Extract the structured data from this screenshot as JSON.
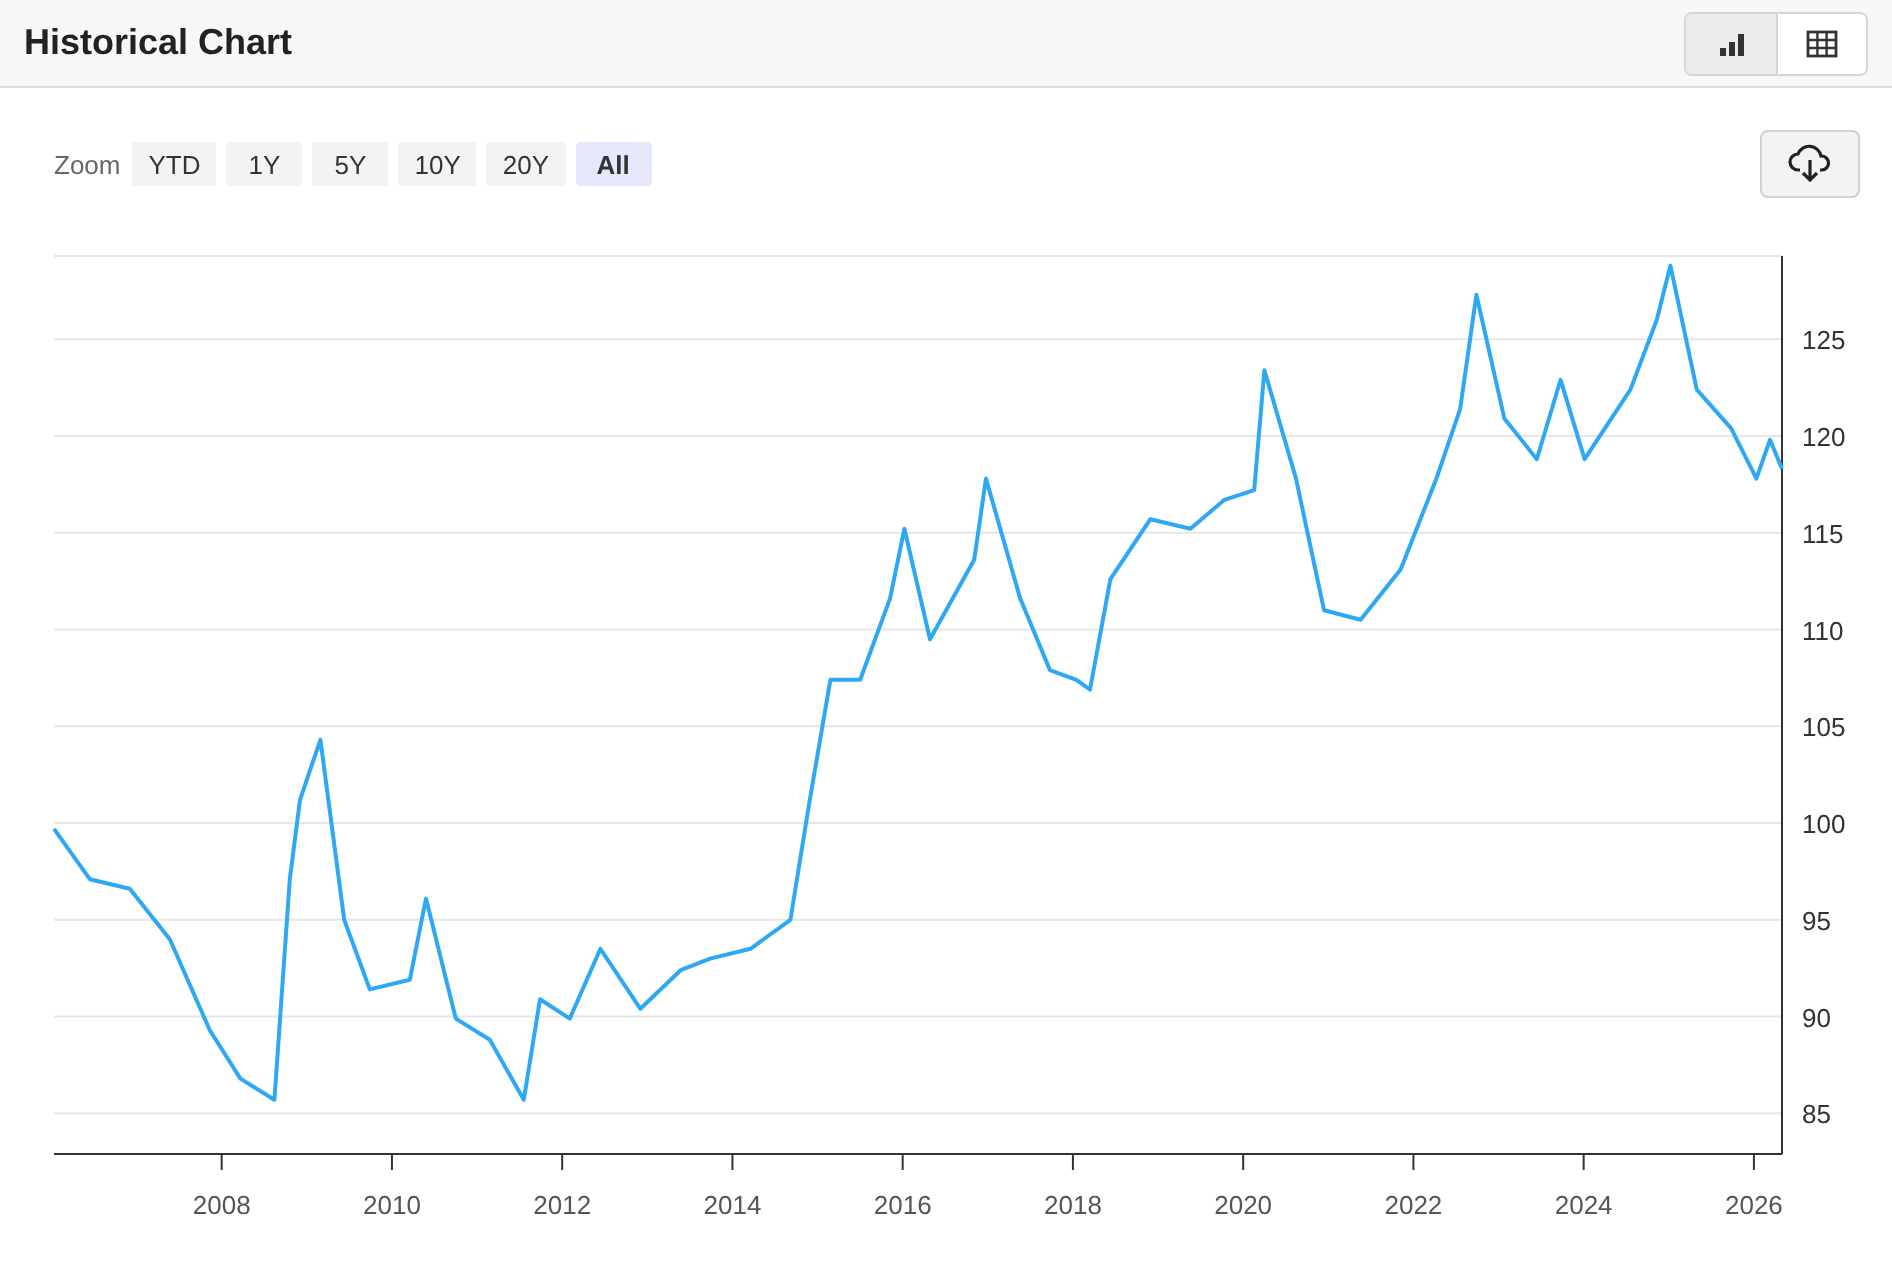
{
  "header": {
    "title": "Historical Chart",
    "views": [
      {
        "kind": "chart",
        "selected": true
      },
      {
        "kind": "table",
        "selected": false
      }
    ]
  },
  "zoom": {
    "label": "Zoom",
    "ranges": [
      {
        "label": "YTD",
        "selected": false
      },
      {
        "label": "1Y",
        "selected": false
      },
      {
        "label": "5Y",
        "selected": false
      },
      {
        "label": "10Y",
        "selected": false
      },
      {
        "label": "20Y",
        "selected": false
      },
      {
        "label": "All",
        "selected": true
      }
    ]
  },
  "chart_data": {
    "type": "line",
    "grid": true,
    "xlim": [
      2006.03,
      2026.33
    ],
    "ylim": [
      82.9,
      129.3
    ],
    "xticks": [
      2008,
      2010,
      2012,
      2014,
      2016,
      2018,
      2020,
      2022,
      2024,
      2026
    ],
    "yticks": [
      85,
      90,
      95,
      100,
      105,
      110,
      115,
      120,
      125
    ],
    "x": [
      2006.03,
      2006.45,
      2006.92,
      2007.39,
      2007.86,
      2008.22,
      2008.62,
      2008.8,
      2008.92,
      2009.16,
      2009.44,
      2009.74,
      2010.21,
      2010.4,
      2010.75,
      2011.15,
      2011.55,
      2011.74,
      2012.09,
      2012.45,
      2012.92,
      2013.39,
      2013.74,
      2014.21,
      2014.68,
      2014.91,
      2015.15,
      2015.5,
      2015.85,
      2016.02,
      2016.32,
      2016.84,
      2016.98,
      2017.38,
      2017.73,
      2018.04,
      2018.2,
      2018.44,
      2018.91,
      2019.38,
      2019.78,
      2020.13,
      2020.25,
      2020.62,
      2020.95,
      2021.38,
      2021.85,
      2022.27,
      2022.55,
      2022.74,
      2023.07,
      2023.45,
      2023.73,
      2024.01,
      2024.55,
      2024.86,
      2025.02,
      2025.33,
      2025.73,
      2026.03,
      2026.19,
      2026.33
    ],
    "series": [
      {
        "color": "#2ea8f5",
        "values": [
          99.7,
          97.1,
          96.6,
          94.0,
          89.3,
          86.8,
          85.7,
          97.1,
          101.2,
          104.3,
          95.0,
          91.4,
          91.9,
          96.1,
          89.9,
          88.8,
          85.7,
          90.9,
          89.9,
          93.5,
          90.4,
          92.4,
          93.0,
          93.5,
          95.0,
          101.2,
          107.4,
          107.4,
          111.6,
          115.2,
          109.5,
          113.6,
          117.8,
          111.6,
          107.9,
          107.4,
          106.9,
          112.6,
          115.7,
          115.2,
          116.7,
          117.2,
          123.4,
          117.8,
          111.0,
          110.5,
          113.1,
          117.8,
          121.4,
          127.3,
          120.9,
          118.8,
          122.9,
          118.8,
          122.4,
          126.0,
          128.8,
          122.4,
          120.4,
          117.8,
          119.8,
          118.3
        ]
      }
    ]
  }
}
